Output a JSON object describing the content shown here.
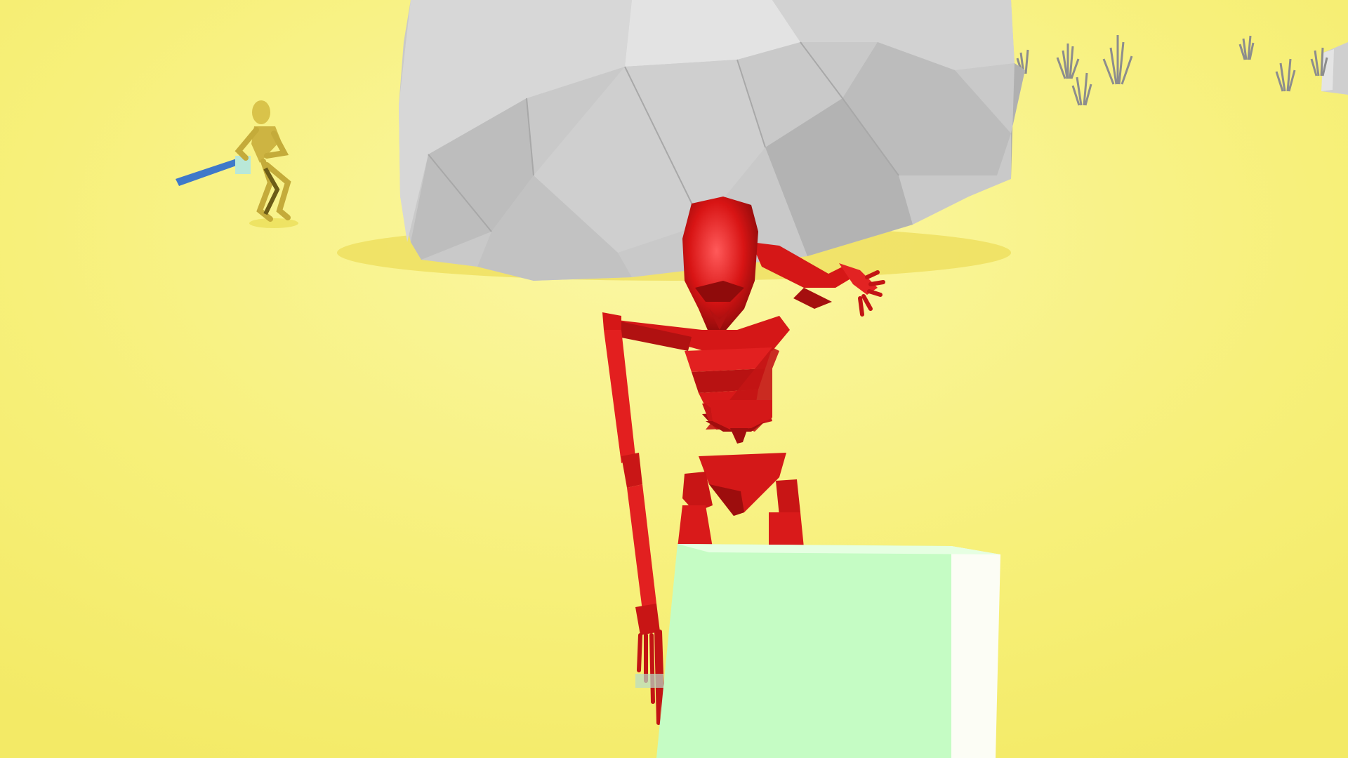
{
  "scene": {
    "type": "first-person 3D game view",
    "hud_text": [],
    "colors": {
      "sky_sand_light": "#fbf8b3",
      "sand": "#f7f27e",
      "sand_shadow": "#eedf55",
      "rock_light": "#dcdcdc",
      "rock_mid": "#c4c4c4",
      "rock_dark": "#a9a9a9",
      "grass": "#8a8a8a",
      "skeleton_near": "#e01b1b",
      "skeleton_near_dark": "#8f0b0b",
      "skeleton_far": "#d9c34a",
      "skeleton_far_dark": "#7a6a1c",
      "enemy_sword": "#3f79c9",
      "held_block_front": "#c5fcc4",
      "held_block_side": "#ffffff"
    }
  }
}
